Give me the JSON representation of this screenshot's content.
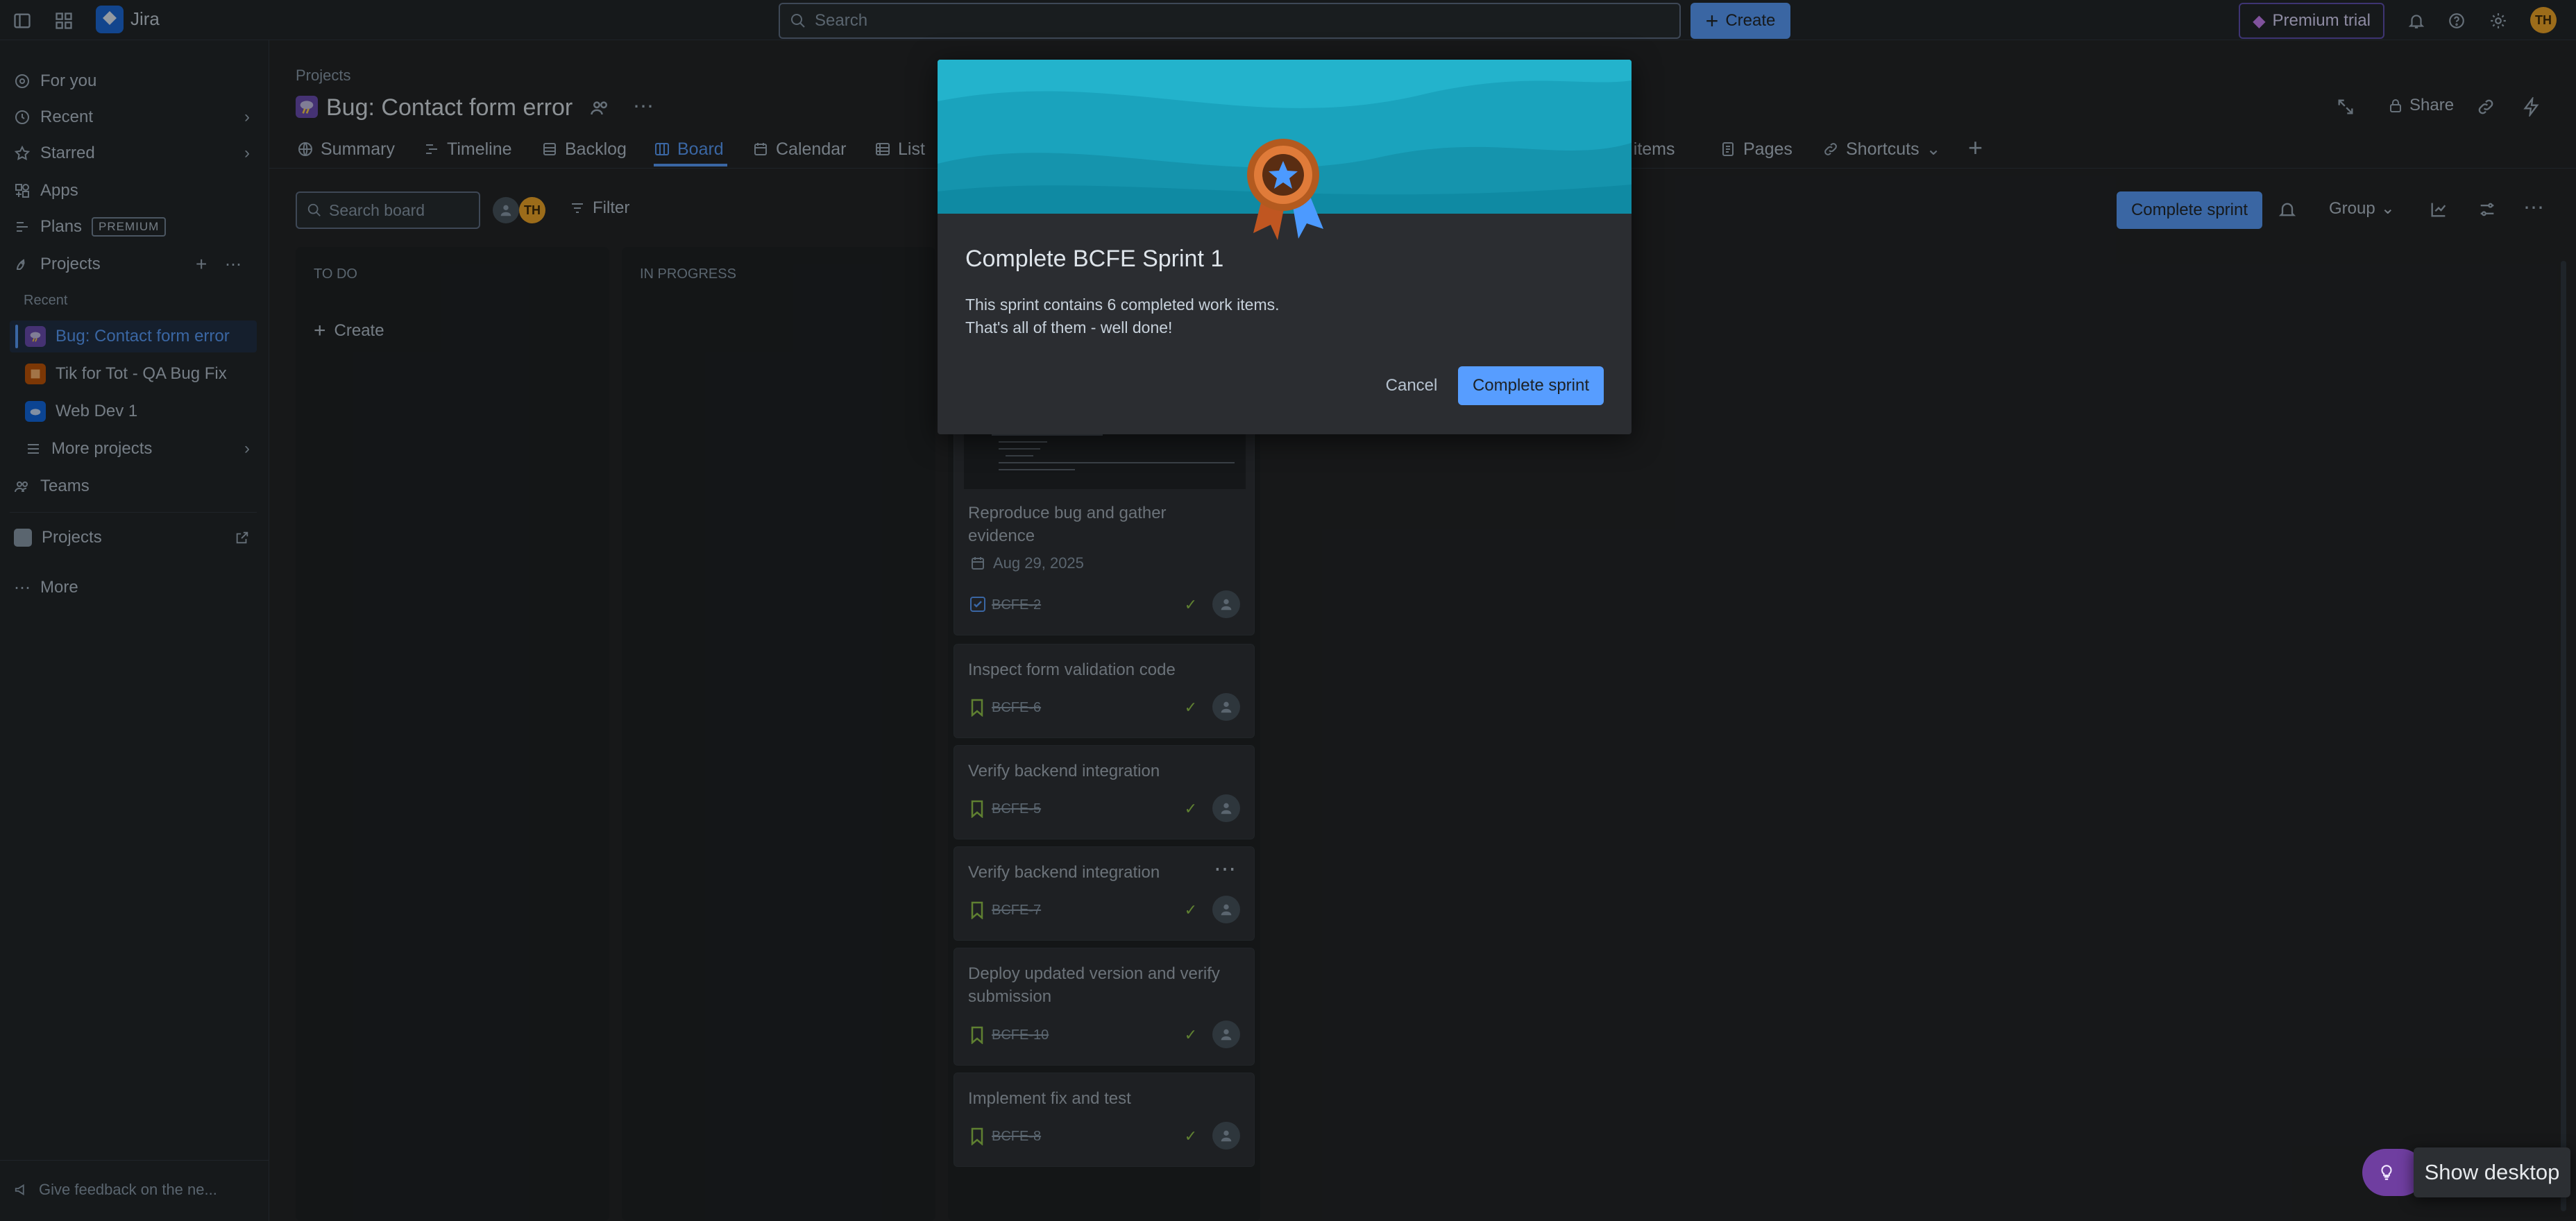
{
  "app": {
    "name": "Jira"
  },
  "topbar": {
    "search_placeholder": "Search",
    "create_label": "Create",
    "premium_label": "Premium trial",
    "avatar_initials": "TH"
  },
  "sidebar": {
    "for_you": "For you",
    "recent": "Recent",
    "starred": "Starred",
    "apps": "Apps",
    "plans": "Plans",
    "plans_badge": "PREMIUM",
    "projects": "Projects",
    "recent_header": "Recent",
    "recent_projects": [
      "Bug: Contact form error",
      "Tik for Tot - QA Bug Fix",
      "Web Dev 1"
    ],
    "more_projects": "More projects",
    "teams": "Teams",
    "projects_link": "Projects",
    "more": "More",
    "feedback": "Give feedback on the ne..."
  },
  "header": {
    "breadcrumb": "Projects",
    "title": "Bug: Contact form error",
    "share_label": "Share"
  },
  "tabs": {
    "summary": "Summary",
    "timeline": "Timeline",
    "backlog": "Backlog",
    "board": "Board",
    "calendar": "Calendar",
    "list": "List",
    "work_items_partial": "rk items",
    "pages": "Pages",
    "shortcuts": "Shortcuts"
  },
  "toolbar": {
    "search_board_placeholder": "Search board",
    "filter_label": "Filter",
    "complete_sprint_label": "Complete sprint",
    "group_label": "Group"
  },
  "board": {
    "todo_header": "TO DO",
    "inprogress_header": "IN PROGRESS",
    "create_label": "Create",
    "cards": [
      {
        "title": "Reproduce bug and gather evidence",
        "date": "Aug 29, 2025",
        "key": "BCFE-2"
      },
      {
        "title": "Inspect form validation code",
        "key": "BCFE-6"
      },
      {
        "title": "Verify backend integration",
        "key": "BCFE-5"
      },
      {
        "title": "Verify backend integration",
        "key": "BCFE-7"
      },
      {
        "title": "Deploy updated version and verify submission",
        "key": "BCFE-10"
      },
      {
        "title": "Implement fix and test",
        "key": "BCFE-8"
      }
    ]
  },
  "modal": {
    "title": "Complete BCFE Sprint 1",
    "line1": "This sprint contains 6 completed work items.",
    "line2": "That's all of them - well done!",
    "cancel_label": "Cancel",
    "confirm_label": "Complete sprint"
  },
  "toast": {
    "label": "Show desktop"
  },
  "colors": {
    "accent": "#579dff",
    "banner": "#1aa3bd",
    "avatar": "#f5a623",
    "done_check": "#94c748"
  }
}
